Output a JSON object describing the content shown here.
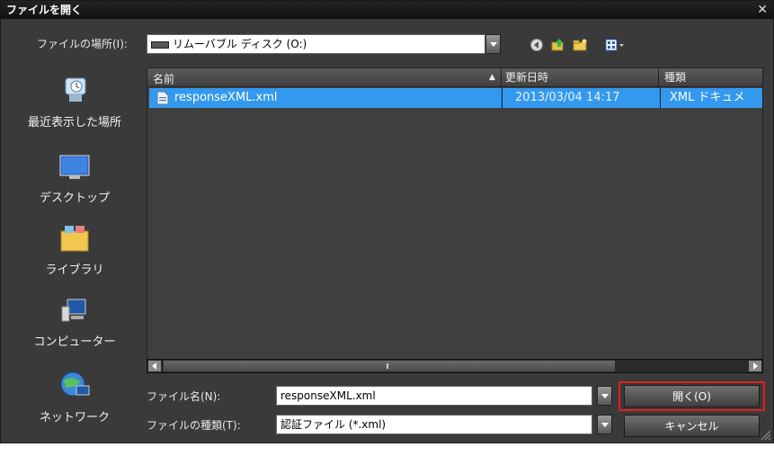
{
  "title": "ファイルを開く",
  "close_glyph": "✕",
  "location": {
    "label": "ファイルの場所(I):",
    "value": "リムーバブル ディスク (O:)"
  },
  "places": [
    {
      "label": "最近表示した場所",
      "icon": "recent-places-icon"
    },
    {
      "label": "デスクトップ",
      "icon": "desktop-icon"
    },
    {
      "label": "ライブラリ",
      "icon": "libraries-icon"
    },
    {
      "label": "コンピューター",
      "icon": "computer-icon"
    },
    {
      "label": "ネットワーク",
      "icon": "network-icon"
    }
  ],
  "columns": {
    "name": "名前",
    "date": "更新日時",
    "type": "種類"
  },
  "files": [
    {
      "name": "responseXML.xml",
      "date": "2013/03/04 14:17",
      "type": "XML ドキュメ"
    }
  ],
  "filename": {
    "label": "ファイル名(N):",
    "value": "responseXML.xml"
  },
  "filetype": {
    "label": "ファイルの種類(T):",
    "value": "認証ファイル (*.xml)"
  },
  "buttons": {
    "open": "開く(O)",
    "cancel": "キャンセル"
  },
  "colors": {
    "selection": "#3399ee",
    "highlight_border": "#e02020"
  }
}
